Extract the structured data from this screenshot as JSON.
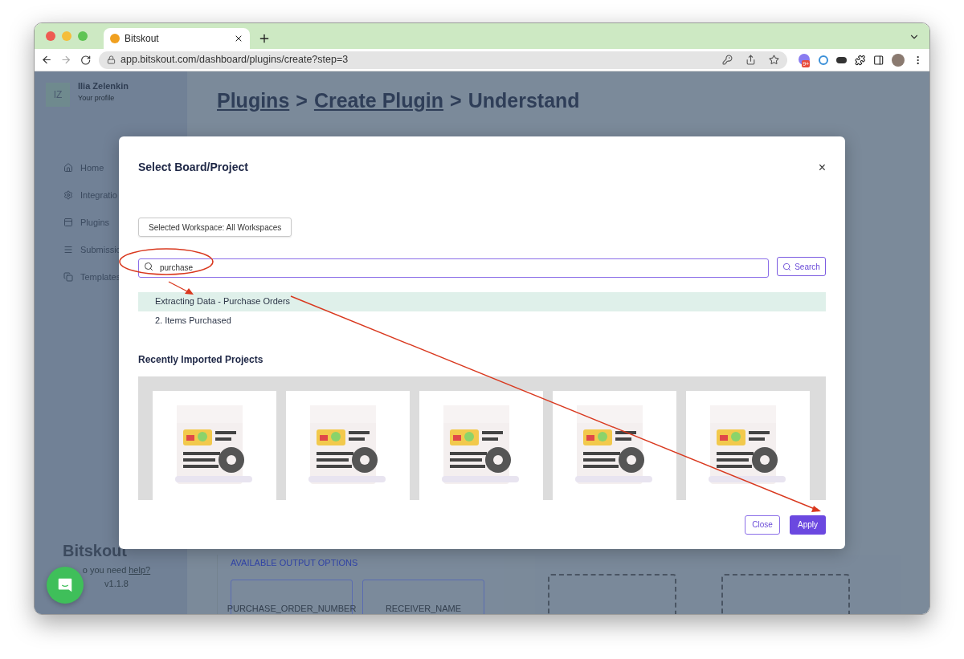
{
  "browser": {
    "tab_title": "Bitskout",
    "url": "app.bitskout.com/dashboard/plugins/create?step=3",
    "extension_badge": "9+"
  },
  "sidebar": {
    "avatar": "IZ",
    "user_name": "Ilia Zelenkin",
    "profile_link": "Your profile",
    "items": [
      {
        "label": "Home"
      },
      {
        "label": "Integratio"
      },
      {
        "label": "Plugins"
      },
      {
        "label": "Submissio"
      },
      {
        "label": "Templates"
      }
    ],
    "logo": "Bitskout",
    "help_text": "o you need",
    "help_link": "help?",
    "version": "v1.1.8"
  },
  "page": {
    "breadcrumb": [
      {
        "kind": "link",
        "label": "Plugins"
      },
      {
        "kind": "separator",
        "label": ">"
      },
      {
        "kind": "link",
        "label": "Create Plugin"
      },
      {
        "kind": "separator",
        "label": ">"
      },
      {
        "kind": "current",
        "label": "Understand"
      }
    ],
    "output_label": "AVAILABLE OUTPUT OPTIONS",
    "outputs": [
      "PURCHASE_ORDER_NUMBER",
      "RECEIVER_NAME"
    ]
  },
  "modal": {
    "title": "Select Board/Project",
    "close": "×",
    "workspace_button": "Selected Workspace: All Workspaces",
    "search": {
      "value": "purchase",
      "button": "Search"
    },
    "results": [
      {
        "label": "Extracting Data - Purchase Orders",
        "selected": true
      },
      {
        "label": "2. Items Purchased",
        "selected": false
      }
    ],
    "recent_heading": "Recently Imported Projects",
    "buttons": {
      "close": "Close",
      "apply": "Apply"
    }
  }
}
